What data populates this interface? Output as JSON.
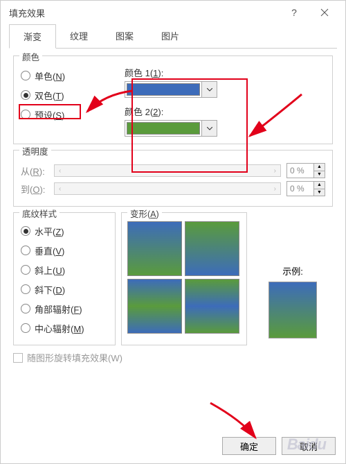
{
  "title": "填充效果",
  "tabs": [
    {
      "label": "渐变",
      "active": true
    },
    {
      "label": "纹理",
      "active": false
    },
    {
      "label": "图案",
      "active": false
    },
    {
      "label": "图片",
      "active": false
    }
  ],
  "color_section": {
    "title": "颜色",
    "radios": {
      "single_prefix": "单色(",
      "single_u": "N",
      "single_suffix": ")",
      "two_prefix": "双色(",
      "two_u": "T",
      "two_suffix": ")",
      "preset_prefix": "预设(",
      "preset_u": "S",
      "preset_suffix": ")"
    },
    "color1_prefix": "颜色 1(",
    "color1_u": "1",
    "color1_suffix": "):",
    "color2_prefix": "颜色 2(",
    "color2_u": "2",
    "color2_suffix": "):",
    "color1_hex": "#3d6cba",
    "color2_hex": "#5a9b3c"
  },
  "transparency": {
    "title": "透明度",
    "from_prefix": "从(",
    "from_u": "R",
    "from_suffix": "):",
    "to_prefix": "到(",
    "to_u": "O",
    "to_suffix": "):",
    "from_value": "0 %",
    "to_value": "0 %"
  },
  "shading": {
    "title": "底纹样式",
    "radios": [
      {
        "pre": "水平(",
        "u": "Z",
        "suf": ")",
        "selected": true
      },
      {
        "pre": "垂直(",
        "u": "V",
        "suf": ")",
        "selected": false
      },
      {
        "pre": "斜上(",
        "u": "U",
        "suf": ")",
        "selected": false
      },
      {
        "pre": "斜下(",
        "u": "D",
        "suf": ")",
        "selected": false
      },
      {
        "pre": "角部辐射(",
        "u": "F",
        "suf": ")",
        "selected": false
      },
      {
        "pre": "中心辐射(",
        "u": "M",
        "suf": ")",
        "selected": false
      }
    ]
  },
  "variant_section": {
    "title_pre": "变形(",
    "title_u": "A",
    "title_suf": ")"
  },
  "sample_label": "示例:",
  "rotate_with_shape": "随图形旋转填充效果(W)",
  "buttons": {
    "ok": "确定",
    "cancel": "取消"
  },
  "watermark": "Baidu"
}
